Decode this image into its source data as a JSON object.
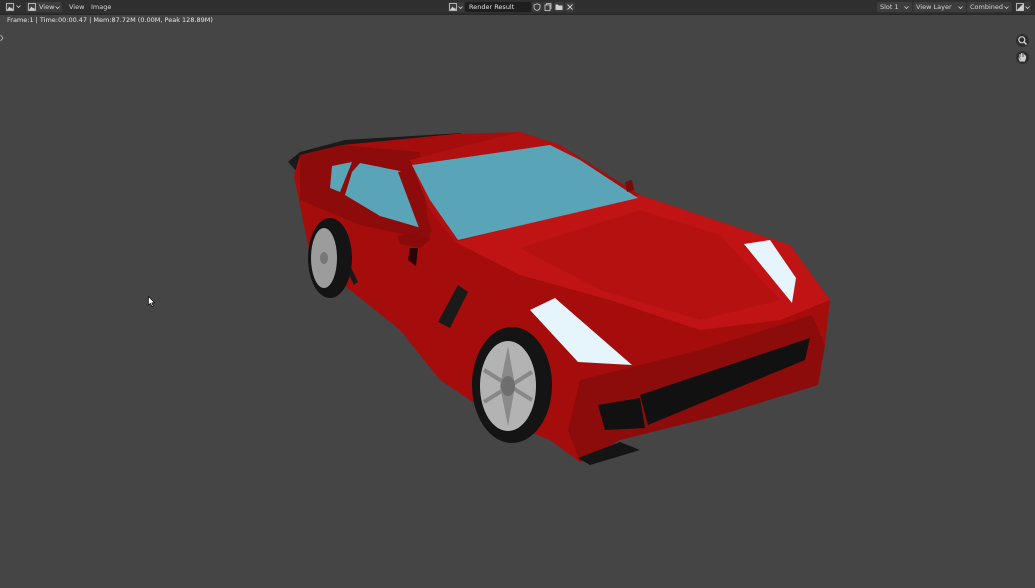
{
  "header": {
    "editor_icon": "image-editor-icon",
    "view_dropdown": "View",
    "menu": [
      "View",
      "Image"
    ],
    "image_name": "Render Result",
    "slot": "Slot 1",
    "view_layer": "View Layer",
    "pass": "Combined"
  },
  "status": {
    "text": "Frame:1 | Time:00:00.47 | Mem:87.72M (0.00M, Peak 128.89M)"
  },
  "render": {
    "subject": "red sports car render",
    "colors": {
      "background": "#454545",
      "body": "#b00f0f",
      "glass": "#5aa4b8",
      "headlight": "#e6f4fb",
      "tire": "#141414"
    }
  },
  "tools": [
    "zoom-icon",
    "pan-hand-icon"
  ]
}
